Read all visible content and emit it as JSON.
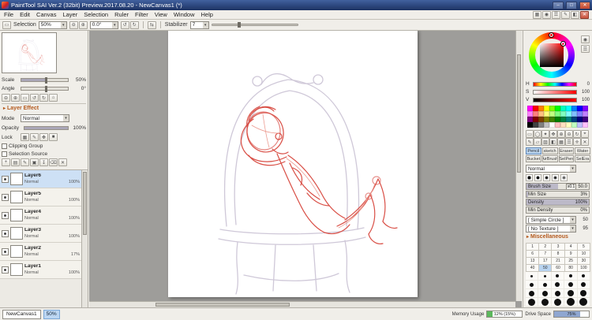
{
  "window": {
    "title": "PaintTool SAI Ver.2 (32bit) Preview.2017.08.20 - NewCanvas1 (*)",
    "minimize": "–",
    "maximize": "□",
    "close": "✕"
  },
  "menu": {
    "items": [
      "File",
      "Edit",
      "Canvas",
      "Layer",
      "Selection",
      "Ruler",
      "Filter",
      "View",
      "Window",
      "Help"
    ]
  },
  "toolbar": {
    "selection_label": "Selection",
    "zoom_value": "50%",
    "angle_value": "0.0°",
    "stabilizer_label": "Stabilizer",
    "stabilizer_value": "7"
  },
  "navigator": {
    "scale_label": "Scale",
    "scale_value": "50%",
    "angle_label": "Angle",
    "angle_value": "0°"
  },
  "layer_panel": {
    "effect_label": "Layer Effect",
    "mode_label": "Mode",
    "mode_value": "Normal",
    "opacity_label": "Opacity",
    "opacity_value": "100%",
    "lock_label": "Lock",
    "clipping_label": "Clipping Group",
    "selection_source_label": "Selection Source",
    "layers": [
      {
        "name": "Layer6",
        "mode": "Normal",
        "opacity": "100%",
        "selected": true
      },
      {
        "name": "Layer5",
        "mode": "Normal",
        "opacity": "100%",
        "selected": false
      },
      {
        "name": "Layer4",
        "mode": "Normal",
        "opacity": "100%",
        "selected": false
      },
      {
        "name": "Layer3",
        "mode": "Normal",
        "opacity": "100%",
        "selected": false
      },
      {
        "name": "Layer2",
        "mode": "Normal",
        "opacity": "17%",
        "selected": false
      },
      {
        "name": "Layer1",
        "mode": "Normal",
        "opacity": "100%",
        "selected": false
      }
    ]
  },
  "color_panel": {
    "h_label": "H",
    "h_value": "0",
    "s_label": "S",
    "s_value": "100",
    "v_label": "V",
    "v_value": "100",
    "swatches": [
      [
        "#ff00ff",
        "#ff0000",
        "#ff8000",
        "#ffff00",
        "#80ff00",
        "#00ff00",
        "#00ffc0",
        "#00ffff",
        "#0080ff",
        "#0000ff",
        "#8000ff"
      ],
      [
        "#ff80ff",
        "#ff8080",
        "#ffc080",
        "#ffff80",
        "#c0ff80",
        "#80ff80",
        "#80ffc0",
        "#80ffff",
        "#80c0ff",
        "#8080ff",
        "#c080ff"
      ],
      [
        "#800080",
        "#800000",
        "#804000",
        "#808000",
        "#408000",
        "#008000",
        "#008040",
        "#008080",
        "#004080",
        "#000080",
        "#400080"
      ],
      [
        "#000000",
        "#404040",
        "#808080",
        "#c0c0c0",
        "#ffffff",
        "#ffc0c0",
        "#ffe0c0",
        "#ffffc0",
        "#c0ffc0",
        "#c0c0ff",
        "#ffc0ff"
      ]
    ]
  },
  "tool_panel": {
    "tools": [
      "Pencil",
      "sketch",
      "Eraser",
      "Water",
      "Bucket",
      "AirBrush",
      "SelPen",
      "SelEra"
    ],
    "selected_tool": "Pencil",
    "blend_value": "Normal",
    "brush_size_label": "Brush Size",
    "brush_size_mult": "x0.1",
    "brush_size_value": "50.0",
    "min_size_label": "Min Size",
    "min_size_value": "3%",
    "density_label": "Density",
    "density_value": "100%",
    "min_density_label": "Min Density",
    "min_density_value": "0%",
    "shape_value": "[ Simple Circle ]",
    "shape_num": "50",
    "texture_value": "[ No Texture ]",
    "texture_num": "95",
    "misc_label": "Miscellaneous",
    "size_presets": [
      [
        "1",
        "2",
        "3",
        "4",
        "5"
      ],
      [
        "6",
        "7",
        "8",
        "9",
        "10"
      ],
      [
        "13",
        "17",
        "21",
        "25",
        "30"
      ],
      [
        "40",
        "50",
        "60",
        "80",
        "100"
      ]
    ],
    "selected_preset": "50"
  },
  "statusbar": {
    "canvas_tab": "NewCanvas1",
    "zoom": "50%",
    "memory_label": "Memory Usage",
    "memory_value": "12% (15%)",
    "memory_fill": "15%",
    "memory_color": "#5cb85c",
    "drive_label": "Drive Space",
    "drive_value": "75%",
    "drive_fill": "75%",
    "drive_color": "#8fa6d0"
  },
  "colors": {
    "accent_selection": "#cde0f5",
    "section_header": "#b55a1e",
    "sketch_red": "#d94f46",
    "sketch_red_light": "#ec9a90",
    "chair_gray": "#c7bfd2",
    "canvas_bg": "#9e9d9a"
  },
  "icons": {
    "menubar_icons": [
      {
        "name": "navigator-panel-icon",
        "glyph": "▦"
      },
      {
        "name": "color-panel-icon",
        "glyph": "◉"
      },
      {
        "name": "layer-panel-icon",
        "glyph": "☰"
      },
      {
        "name": "tool-panel-icon",
        "glyph": "✎"
      },
      {
        "name": "layout-panel-icon",
        "glyph": "◧"
      },
      {
        "name": "close-panel-icon",
        "glyph": "✕",
        "red": true
      }
    ],
    "toolbar_zoom": [
      {
        "name": "zoom-out-icon",
        "glyph": "⊖"
      },
      {
        "name": "zoom-in-icon",
        "glyph": "⊕"
      }
    ],
    "toolbar_rotate": [
      {
        "name": "rotate-ccw-icon",
        "glyph": "↺"
      },
      {
        "name": "rotate-cw-icon",
        "glyph": "↻"
      }
    ],
    "toolbar_misc": [
      {
        "name": "flip-canvas-icon",
        "glyph": "⇆"
      }
    ],
    "nav_buttons": [
      {
        "name": "zoom-out-icon",
        "glyph": "⊖"
      },
      {
        "name": "zoom-in-icon",
        "glyph": "⊕"
      },
      {
        "name": "zoom-fit-icon",
        "glyph": "▭"
      },
      {
        "name": "rotate-ccw-icon",
        "glyph": "↺"
      },
      {
        "name": "rotate-cw-icon",
        "glyph": "↻"
      },
      {
        "name": "reset-view-icon",
        "glyph": "⌂"
      }
    ],
    "lock_icons": [
      {
        "name": "lock-transparency-icon",
        "glyph": "▦"
      },
      {
        "name": "lock-pixels-icon",
        "glyph": "✎"
      },
      {
        "name": "lock-position-icon",
        "glyph": "✥"
      },
      {
        "name": "lock-all-icon",
        "glyph": "■"
      }
    ],
    "layer_toolbar_icons": [
      {
        "name": "new-layer-icon",
        "glyph": "+"
      },
      {
        "name": "new-folder-icon",
        "glyph": "▤"
      },
      {
        "name": "new-lineart-layer-icon",
        "glyph": "✎"
      },
      {
        "name": "duplicate-layer-icon",
        "glyph": "▣"
      },
      {
        "name": "merge-down-icon",
        "glyph": "↧"
      },
      {
        "name": "clear-layer-icon",
        "glyph": "⌫"
      },
      {
        "name": "delete-layer-icon",
        "glyph": "✕"
      }
    ],
    "wheel_side": [
      {
        "name": "wheel-mode-icon",
        "glyph": "◉"
      },
      {
        "name": "slider-mode-icon",
        "glyph": "☰"
      }
    ],
    "tool_row1": [
      {
        "name": "rect-select-icon",
        "glyph": "▭"
      },
      {
        "name": "lasso-icon",
        "glyph": "◯"
      },
      {
        "name": "magic-wand-icon",
        "glyph": "✦"
      },
      {
        "name": "move-icon",
        "glyph": "✥"
      },
      {
        "name": "zoom-in-icon",
        "glyph": "⊕"
      },
      {
        "name": "zoom-out-icon",
        "glyph": "⊖"
      },
      {
        "name": "rotate-icon",
        "glyph": "↻"
      },
      {
        "name": "eyedropper-icon",
        "glyph": "⌖"
      }
    ],
    "tool_row2": [
      {
        "name": "pen-icon",
        "glyph": "✎"
      },
      {
        "name": "shape-icon",
        "glyph": "▱"
      },
      {
        "name": "hatch-icon",
        "glyph": "▨"
      },
      {
        "name": "halftone-icon",
        "glyph": "◧"
      },
      {
        "name": "grid-icon",
        "glyph": "▦"
      },
      {
        "name": "lines-icon",
        "glyph": "☰"
      },
      {
        "name": "cross-icon",
        "glyph": "✛"
      },
      {
        "name": "clear-icon",
        "glyph": "✕"
      }
    ]
  }
}
